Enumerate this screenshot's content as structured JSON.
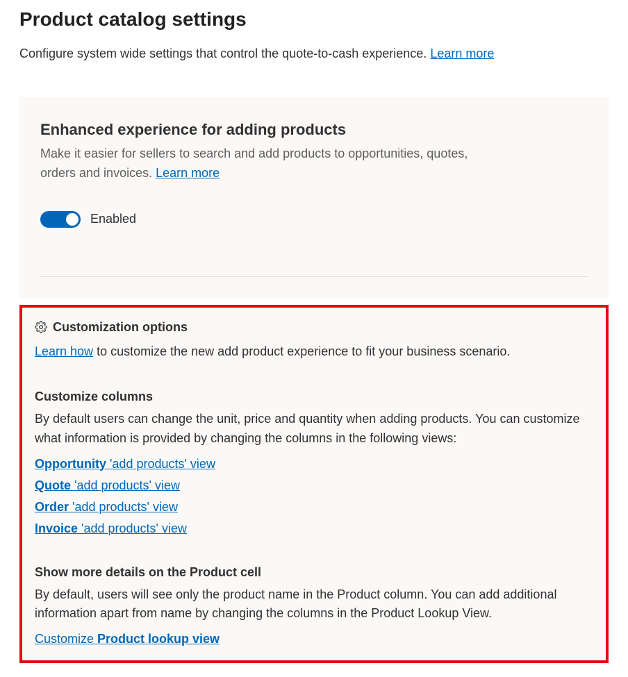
{
  "page": {
    "title": "Product catalog settings",
    "subtitle_text": "Configure system wide settings that control the quote-to-cash experience. ",
    "subtitle_link": "Learn more"
  },
  "enhanced": {
    "title": "Enhanced experience for adding products",
    "desc_text": "Make it easier for sellers to search and add products to opportunities, quotes, orders and invoices. ",
    "desc_link": "Learn more",
    "toggle_label": "Enabled"
  },
  "customization": {
    "header": "Customization options",
    "intro_link": "Learn how",
    "intro_text": " to customize the new add product experience to fit your business scenario.",
    "columns": {
      "title": "Customize columns",
      "desc": "By default users can change the unit, price and quantity when adding products. You can customize what information is provided by changing the columns in the following views:",
      "views": [
        {
          "bold": "Opportunity",
          "rest": " 'add products' view"
        },
        {
          "bold": "Quote",
          "rest": " 'add products' view"
        },
        {
          "bold": "Order",
          "rest": " 'add products' view"
        },
        {
          "bold": "Invoice",
          "rest": " 'add products' view"
        }
      ]
    },
    "product_cell": {
      "title": "Show more details on the Product cell",
      "desc": "By default, users will see only the product name in the Product column. You can add additional information apart from name by changing the columns in the Product Lookup View.",
      "link_prefix": "Customize ",
      "link_bold": "Product lookup view"
    }
  }
}
